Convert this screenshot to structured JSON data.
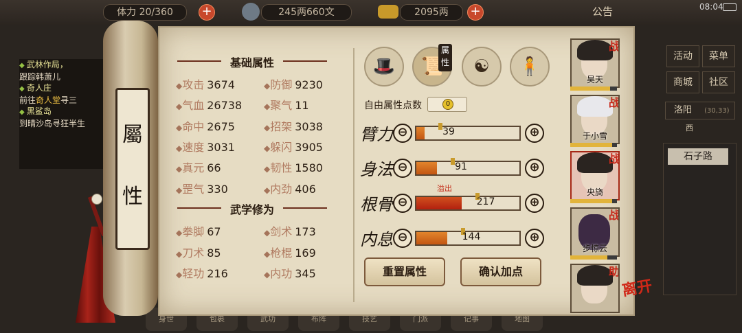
{
  "topbar": {
    "stamina_label": "体力",
    "stamina_value": "20/360",
    "copper": "245两660文",
    "silver": "2095两",
    "notice": "公告",
    "time": "08:04"
  },
  "quests": [
    {
      "title": "武林作局，",
      "desc_pre": "跟踪韩萧儿",
      "desc_hl": "",
      "desc_post": ""
    },
    {
      "title": "奇人庄",
      "desc_pre": "前往",
      "desc_hl": "奇人堂",
      "desc_post": "寻三"
    },
    {
      "title": "黑鲨岛",
      "desc_pre": "到晴沙岛寻狂半生",
      "desc_hl": "",
      "desc_post": ""
    }
  ],
  "right_menu": {
    "activity": "活动",
    "menu": "菜单",
    "shop": "商城",
    "community": "社区",
    "city": "洛阳",
    "city_coords": "(30,33)",
    "compass": "西",
    "location": "石子路"
  },
  "bottom_bar": [
    "身世",
    "包裹",
    "武功",
    "布阵",
    "技艺",
    "门派",
    "记事",
    "地图"
  ],
  "scroll": {
    "title_top": "屬",
    "title_bottom": "性"
  },
  "base_attrs": {
    "title": "基础属性",
    "stats": [
      {
        "label": "攻击",
        "value": "3674"
      },
      {
        "label": "防御",
        "value": "9230"
      },
      {
        "label": "气血",
        "value": "26738"
      },
      {
        "label": "聚气",
        "value": "11"
      },
      {
        "label": "命中",
        "value": "2675"
      },
      {
        "label": "招架",
        "value": "3038"
      },
      {
        "label": "速度",
        "value": "3031"
      },
      {
        "label": "躲闪",
        "value": "3905"
      },
      {
        "label": "真元",
        "value": "66"
      },
      {
        "label": "韧性",
        "value": "1580"
      },
      {
        "label": "罡气",
        "value": "330"
      },
      {
        "label": "内劲",
        "value": "406"
      }
    ]
  },
  "martial": {
    "title": "武学修为",
    "stats": [
      {
        "label": "拳脚",
        "value": "67"
      },
      {
        "label": "剑术",
        "value": "173"
      },
      {
        "label": "刀术",
        "value": "85"
      },
      {
        "label": "枪棍",
        "value": "169"
      },
      {
        "label": "轻功",
        "value": "216"
      },
      {
        "label": "内功",
        "value": "345"
      }
    ]
  },
  "tabs": {
    "active_label": "属性"
  },
  "free_points": {
    "label": "自由属性点数",
    "value": "0"
  },
  "attributes": [
    {
      "label": "臂力",
      "value": "39",
      "fill": 0.08,
      "over": false
    },
    {
      "label": "身法",
      "value": "91",
      "fill": 0.2,
      "over": false
    },
    {
      "label": "根骨",
      "value": "217",
      "fill": 0.44,
      "over": true
    },
    {
      "label": "内息",
      "value": "144",
      "fill": 0.3,
      "over": false
    }
  ],
  "overflow_label": "溢出",
  "minus_symbol": "⊖",
  "plus_symbol": "⊕",
  "buttons": {
    "reset": "重置属性",
    "confirm": "确认加点"
  },
  "party": [
    {
      "name": "昊天",
      "role": "战",
      "hp": 0.85
    },
    {
      "name": "于小雪",
      "role": "战",
      "hp": 0.9
    },
    {
      "name": "央旖",
      "role": "战",
      "hp": 0.9
    },
    {
      "name": "步惊云",
      "role": "战",
      "hp": 0.8
    },
    {
      "name": "",
      "role": "助",
      "hp": 1.0
    }
  ],
  "leave_label": "离开",
  "colors": {
    "accent_red": "#c8281a",
    "paper": "#e6dcc3",
    "bar_fill": "#e2842c"
  }
}
